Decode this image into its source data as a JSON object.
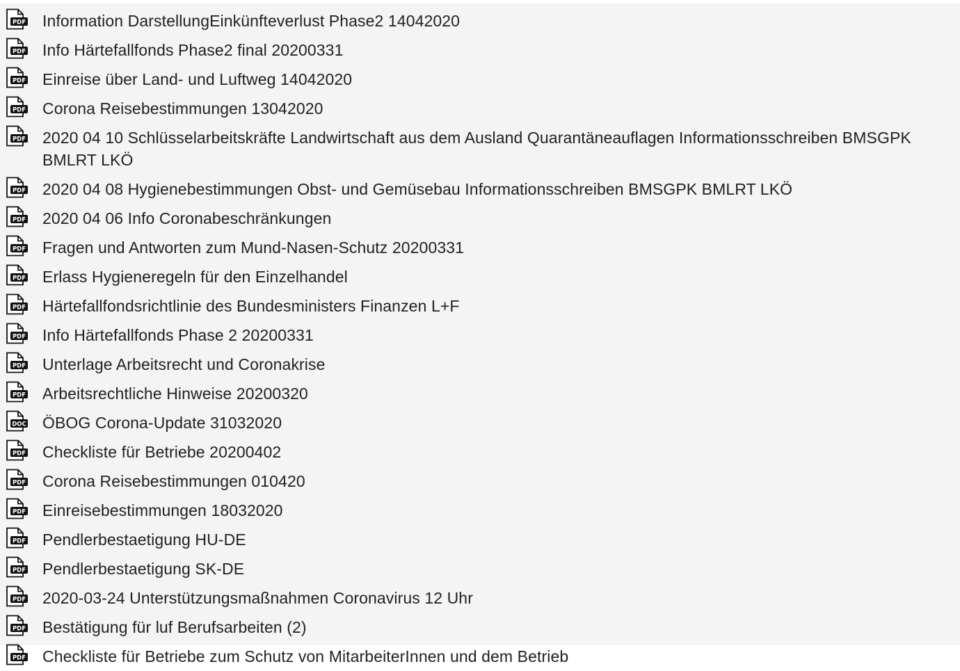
{
  "documents": [
    {
      "label": "Information DarstellungEinkünfteverlust Phase2 14042020",
      "type": "PDF",
      "icon": "pdf-file-icon"
    },
    {
      "label": "Info Härtefallfonds Phase2 final 20200331",
      "type": "PDF",
      "icon": "pdf-file-icon"
    },
    {
      "label": "Einreise über Land- und Luftweg 14042020",
      "type": "PDF",
      "icon": "pdf-file-icon"
    },
    {
      "label": "Corona Reisebestimmungen 13042020",
      "type": "PDF",
      "icon": "pdf-file-icon"
    },
    {
      "label": "2020 04 10 Schlüsselarbeitskräfte Landwirtschaft aus dem Ausland Quarantäneauflagen Informationsschreiben BMSGPK BMLRT LKÖ",
      "type": "PDF",
      "icon": "pdf-file-icon"
    },
    {
      "label": "2020 04 08 Hygienebestimmungen Obst- und Gemüsebau Informationsschreiben BMSGPK BMLRT LKÖ",
      "type": "PDF",
      "icon": "pdf-file-icon"
    },
    {
      "label": "2020 04 06 Info Coronabeschränkungen",
      "type": "PDF",
      "icon": "pdf-file-icon"
    },
    {
      "label": "Fragen und Antworten zum Mund-Nasen-Schutz 20200331",
      "type": "PDF",
      "icon": "pdf-file-icon"
    },
    {
      "label": "Erlass Hygieneregeln für den Einzelhandel",
      "type": "PDF",
      "icon": "pdf-file-icon"
    },
    {
      "label": "Härtefallfondsrichtlinie des Bundesministers Finanzen L+F",
      "type": "PDF",
      "icon": "pdf-file-icon"
    },
    {
      "label": "Info Härtefallfonds Phase 2 20200331",
      "type": "PDF",
      "icon": "pdf-file-icon"
    },
    {
      "label": "Unterlage Arbeitsrecht und Coronakrise",
      "type": "PDF",
      "icon": "pdf-file-icon"
    },
    {
      "label": "Arbeitsrechtliche Hinweise 20200320",
      "type": "PDF",
      "icon": "pdf-file-icon"
    },
    {
      "label": "ÖBOG Corona-Update 31032020",
      "type": "DOC",
      "icon": "doc-file-icon"
    },
    {
      "label": "Checkliste für Betriebe 20200402",
      "type": "PDF",
      "icon": "pdf-file-icon"
    },
    {
      "label": "Corona Reisebestimmungen 010420",
      "type": "PDF",
      "icon": "pdf-file-icon"
    },
    {
      "label": "Einreisebestimmungen 18032020",
      "type": "PDF",
      "icon": "pdf-file-icon"
    },
    {
      "label": "Pendlerbestaetigung HU-DE",
      "type": "PDF",
      "icon": "pdf-file-icon"
    },
    {
      "label": "Pendlerbestaetigung SK-DE",
      "type": "PDF",
      "icon": "pdf-file-icon"
    },
    {
      "label": "2020-03-24 Unterstützungsmaßnahmen Coronavirus 12 Uhr",
      "type": "PDF",
      "icon": "pdf-file-icon"
    },
    {
      "label": "Bestätigung für luf Berufsarbeiten (2)",
      "type": "PDF",
      "icon": "pdf-file-icon"
    },
    {
      "label": "Checkliste für Betriebe zum Schutz von MitarbeiterInnen und dem Betrieb",
      "type": "PDF",
      "icon": "pdf-file-icon"
    }
  ]
}
